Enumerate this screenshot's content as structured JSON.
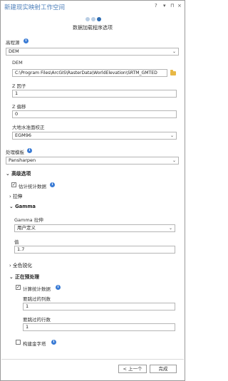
{
  "window": {
    "title": "新建现实映射工作空间",
    "help": "?",
    "menu": "▾",
    "pin": "⊓",
    "close": "×"
  },
  "wizard": {
    "step_title": "数据加载程序选项",
    "steps_total": 3,
    "current_step": 3
  },
  "form": {
    "data_source": {
      "label": "高程源",
      "value": "DEM"
    },
    "dem": {
      "label": "DEM",
      "path": "C:\\Program Files\\ArcGIS\\RasterData\\WorldElevation\\SRTM_GMTED"
    },
    "z_factor": {
      "label": "Z 因子",
      "value": "1"
    },
    "z_offset": {
      "label": "Z 偏移",
      "value": "0"
    },
    "geoid": {
      "label": "大地水准面校正",
      "value": "EGM96"
    },
    "processing_template": {
      "label": "处理模板",
      "value": "Pansharpen"
    }
  },
  "sections": {
    "advanced": {
      "label": "高级选项",
      "estimate_stats": {
        "label": "估计统计数据",
        "checked": true
      },
      "stretch": {
        "label": "拉伸"
      },
      "gamma": {
        "label": "Gamma",
        "stretch": {
          "label": "Gamma 拉伸",
          "value": "用户定义"
        },
        "value": {
          "label": "值",
          "value": "1.7"
        }
      },
      "pan_sharpen": {
        "label": "全色锐化"
      },
      "preprocessing": {
        "label": "正在预处理",
        "calc_stats": {
          "label": "计算统计数据",
          "checked": true
        },
        "skip_cols": {
          "label": "要跳过的列数",
          "value": "1"
        },
        "skip_rows": {
          "label": "要跳过的行数",
          "value": "1"
        },
        "build_pyramids": {
          "label": "构建金字塔",
          "checked": false
        }
      }
    }
  },
  "footer": {
    "previous_label": "< 上一个",
    "finish_label": "完成"
  },
  "icons": {
    "info": "i",
    "chevron_down": "⌄",
    "chevron_right": "›",
    "check": "✓"
  },
  "colors": {
    "title": "#4d7fba",
    "accent": "#2f6db3",
    "info": "#3a7bd5"
  }
}
